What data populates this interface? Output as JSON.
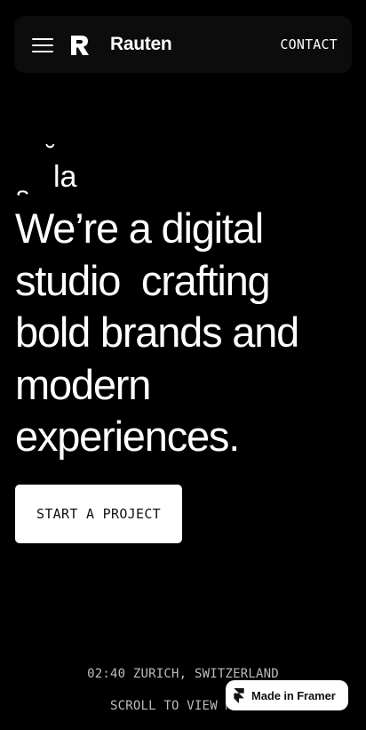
{
  "navbar": {
    "menu_icon": "hamburger-menu-icon",
    "logo_icon": "rauten-logo-icon",
    "brand_name": "Rauten",
    "contact_label": "CONTACT"
  },
  "hero": {
    "animated_fragments": {
      "la": "la",
      "s": "s",
      "tick": "˘"
    },
    "headline_lines": [
      "We’re a digital",
      "studio  crafting",
      "bold brands and",
      "modern",
      "experiences."
    ],
    "cta_label": "START A PROJECT"
  },
  "footer": {
    "location": "02:40 ZURICH, SWITZERLAND",
    "scroll_hint": "SCROLL TO VIEW MORE"
  },
  "framer_badge": {
    "icon": "framer-logo-icon",
    "label": "Made in Framer"
  },
  "colors": {
    "background": "#000000",
    "navbar_bg": "#0c0c0c",
    "text": "#ffffff",
    "muted_text": "#bdbdbd",
    "button_bg": "#ffffff",
    "button_text": "#111111"
  }
}
